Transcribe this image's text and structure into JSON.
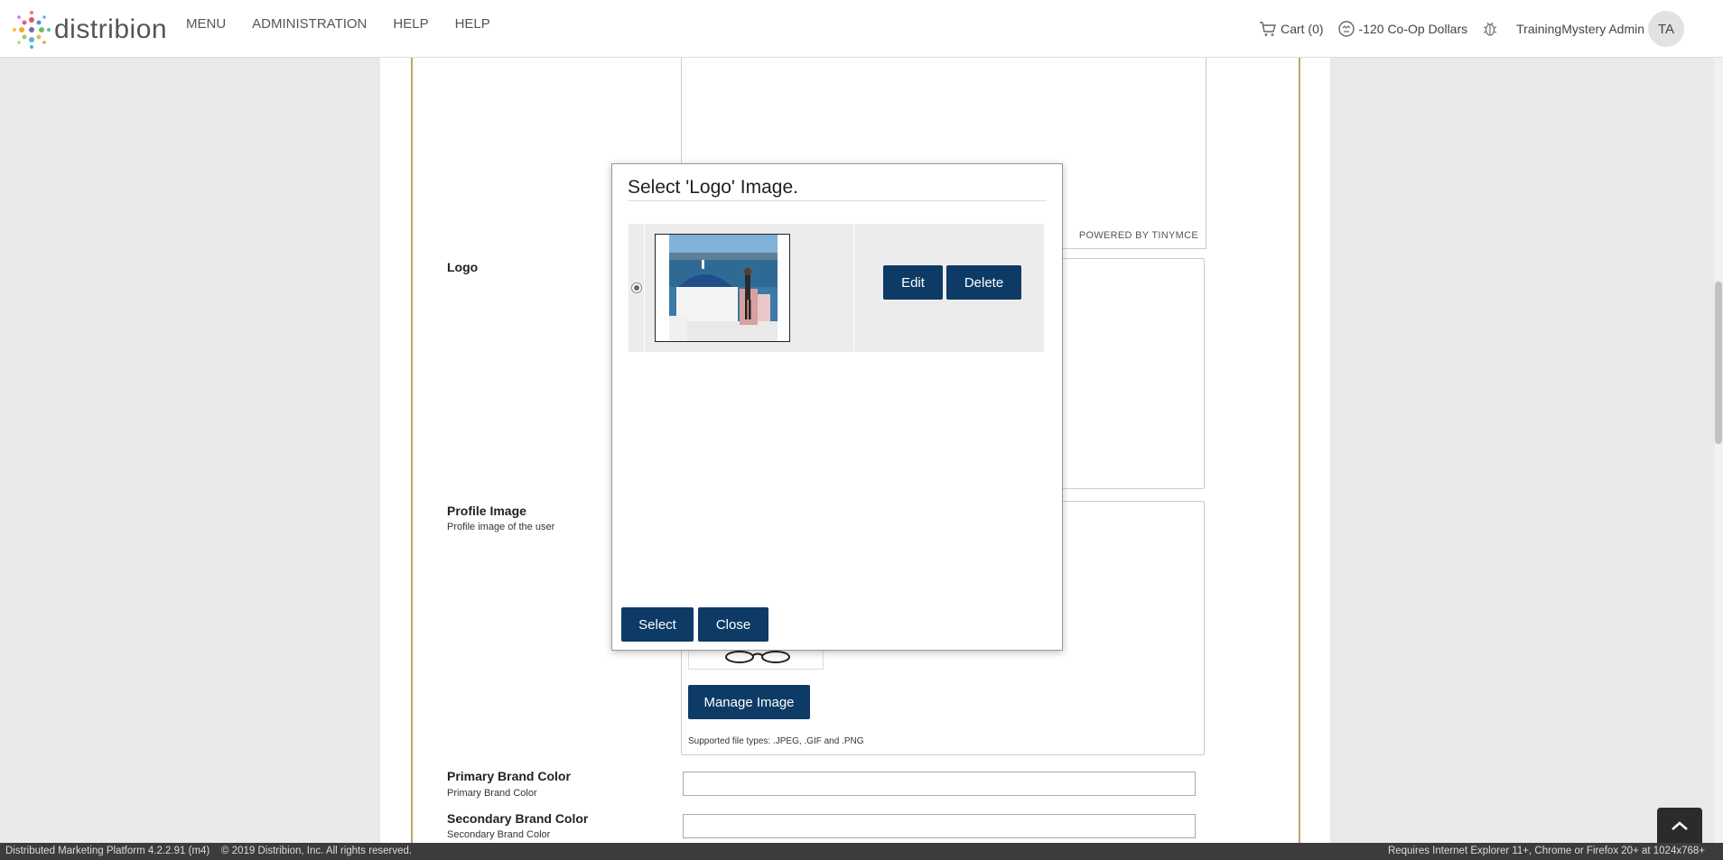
{
  "app": {
    "logo_text": "distribion"
  },
  "nav": {
    "items": [
      "MENU",
      "ADMINISTRATION",
      "HELP",
      "HELP"
    ],
    "cart": "Cart (0)",
    "coop": "-120 Co-Op Dollars",
    "user": "TrainingMystery Admin",
    "avatar": "TA"
  },
  "form": {
    "editor_powered": "POWERED BY TINYMCE",
    "logo_label": "Logo",
    "profile_label": "Profile Image",
    "profile_desc": "Profile image of the user",
    "manage_image": "Manage Image",
    "supported": "Supported file types: .JPEG, .GIF and .PNG",
    "primary_label": "Primary Brand Color",
    "primary_desc": "Primary Brand Color",
    "secondary_label": "Secondary Brand Color",
    "secondary_desc": "Secondary Brand Color"
  },
  "modal": {
    "title": "Select 'Logo' Image.",
    "edit": "Edit",
    "delete": "Delete",
    "select": "Select",
    "close": "Close"
  },
  "footer": {
    "left": "Distributed Marketing Platform 4.2.2.91 (m4)    © 2019 Distribion, Inc. All rights reserved.",
    "right": "Requires Internet Explorer 11+, Chrome or Firefox 20+ at 1024x768+"
  },
  "colors": {
    "primary_button": "#0d3b66",
    "panel_border": "#bba86a"
  }
}
